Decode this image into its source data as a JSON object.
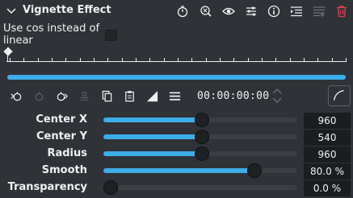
{
  "header": {
    "title": "Vignette Effect",
    "icons": [
      "timer-icon",
      "zoom-icon",
      "eye-icon",
      "sliders-icon",
      "info-icon",
      "list-icon",
      "save-preset-icon",
      "delete-icon"
    ]
  },
  "option": {
    "label": "Use cos instead of linear",
    "checked": false
  },
  "toolbar": {
    "timecode": "00:00:00:00"
  },
  "params": [
    {
      "label": "Center X",
      "value": "960",
      "level": 0.51
    },
    {
      "label": "Center Y",
      "value": "540",
      "level": 0.51
    },
    {
      "label": "Radius",
      "value": "960",
      "level": 0.51
    },
    {
      "label": "Smooth",
      "value": "80.0 %",
      "level": 0.8
    },
    {
      "label": "Transparency",
      "value": "0.0 %",
      "level": 0.0
    }
  ],
  "colors": {
    "accent": "#3daee9",
    "background": "#2f3338",
    "delete": "#da4453"
  }
}
